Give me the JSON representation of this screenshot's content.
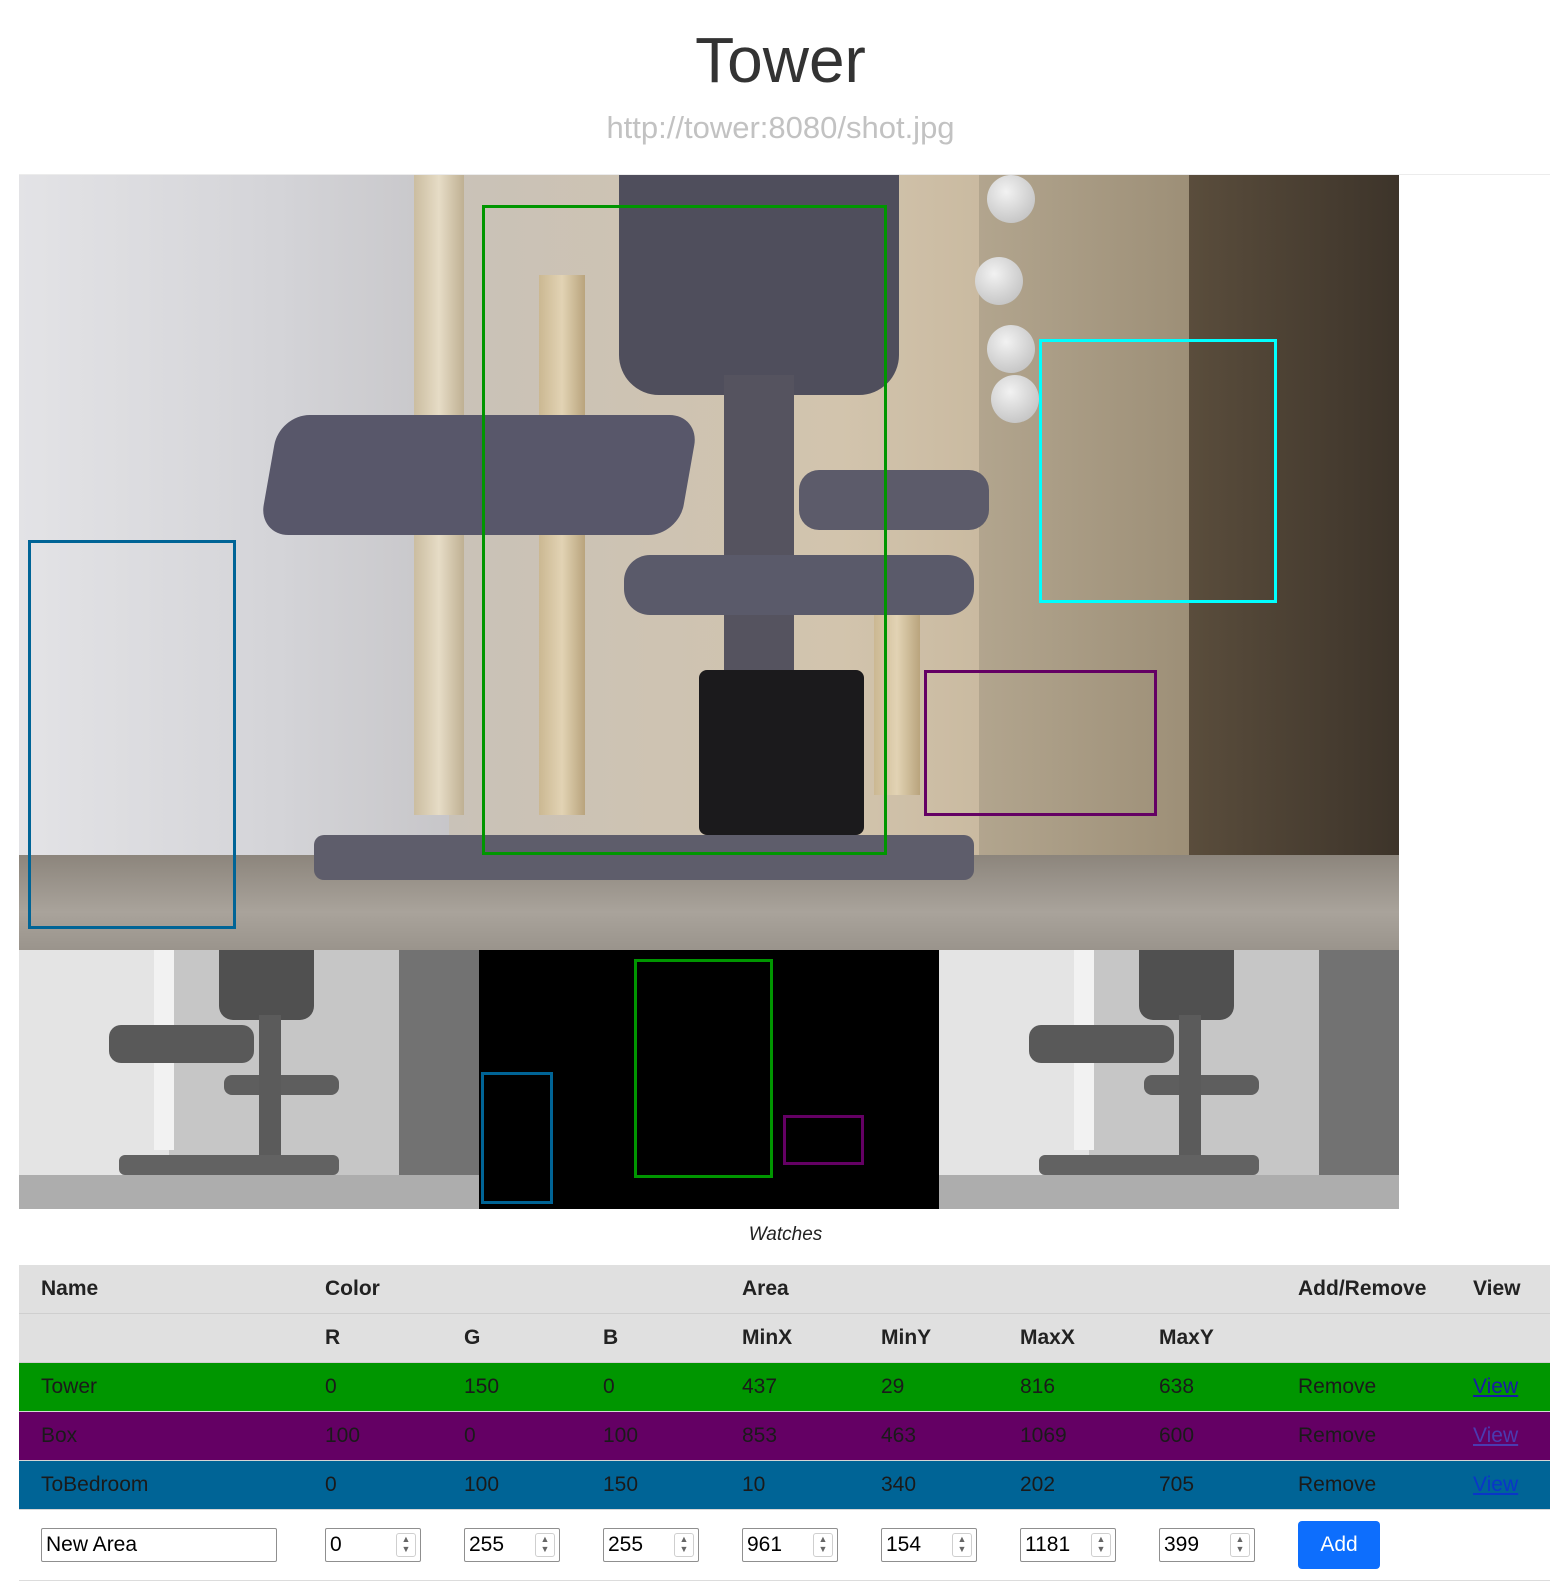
{
  "header": {
    "title": "Tower",
    "url": "http://tower:8080/shot.jpg"
  },
  "camera": {
    "image_alt": "camera snapshot of a cat tower"
  },
  "caption": "Watches",
  "colors": {
    "tower": "#009600",
    "box": "#640064",
    "to_bedroom": "#006496",
    "new_area": "#00ffff",
    "add_button": "#0d6efd"
  },
  "table": {
    "headers": {
      "name": "Name",
      "color": "Color",
      "area": "Area",
      "add_remove": "Add/Remove",
      "view": "View"
    },
    "subheaders": {
      "r": "R",
      "g": "G",
      "b": "B",
      "minx": "MinX",
      "miny": "MinY",
      "maxx": "MaxX",
      "maxy": "MaxY"
    },
    "rows": [
      {
        "name": "Tower",
        "r": "0",
        "g": "150",
        "b": "0",
        "minx": "437",
        "miny": "29",
        "maxx": "816",
        "maxy": "638",
        "action": "Remove",
        "view": "View"
      },
      {
        "name": "Box",
        "r": "100",
        "g": "0",
        "b": "100",
        "minx": "853",
        "miny": "463",
        "maxx": "1069",
        "maxy": "600",
        "action": "Remove",
        "view": "View"
      },
      {
        "name": "ToBedroom",
        "r": "0",
        "g": "100",
        "b": "150",
        "minx": "10",
        "miny": "340",
        "maxx": "202",
        "maxy": "705",
        "action": "Remove",
        "view": "View"
      }
    ],
    "new_area": {
      "name": "New Area",
      "r": "0",
      "g": "255",
      "b": "255",
      "minx": "961",
      "miny": "154",
      "maxx": "1181",
      "maxy": "399",
      "add_label": "Add"
    }
  }
}
